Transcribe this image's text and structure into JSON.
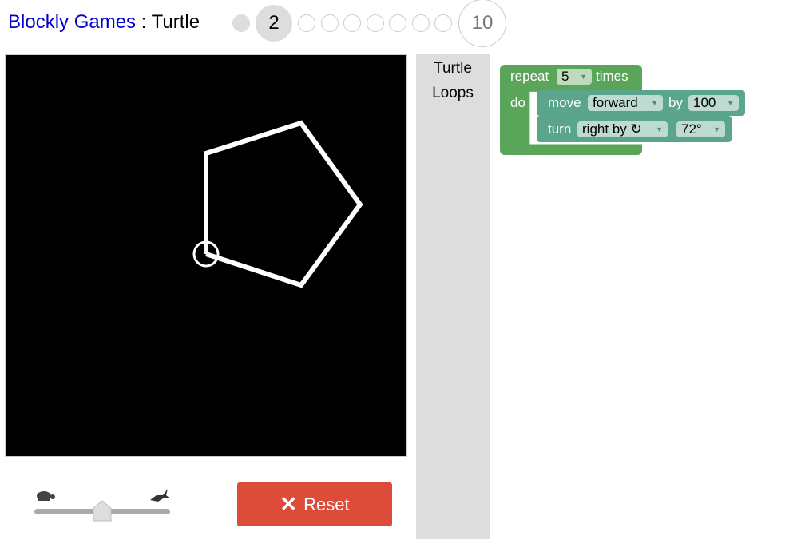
{
  "header": {
    "app": "Blockly Games",
    "sep": " : ",
    "game": "Turtle"
  },
  "levels": {
    "current": "2",
    "last": "10",
    "total": 10,
    "completed": [
      1
    ]
  },
  "toolbox": {
    "categories": [
      "Turtle",
      "Loops"
    ]
  },
  "blocks": {
    "repeat": {
      "label": "repeat",
      "count": "5",
      "times": "times",
      "do": "do",
      "color": "#5ba55b"
    },
    "move": {
      "label": "move",
      "direction": "forward",
      "by": "by",
      "amount": "100",
      "color": "#5ba58c"
    },
    "turn": {
      "label": "turn",
      "direction": "right by ↻",
      "angle": "72°",
      "color": "#5ba58c"
    }
  },
  "speed_slider": {
    "value": 0.5,
    "slow_icon": "turtle-icon",
    "fast_icon": "rabbit-icon"
  },
  "reset_button": {
    "label": "Reset",
    "icon": "x-icon",
    "color": "#dd4b39"
  },
  "drawing": {
    "shape": "pentagon",
    "side": 100,
    "turn": 72,
    "stroke": "#ffffff"
  }
}
